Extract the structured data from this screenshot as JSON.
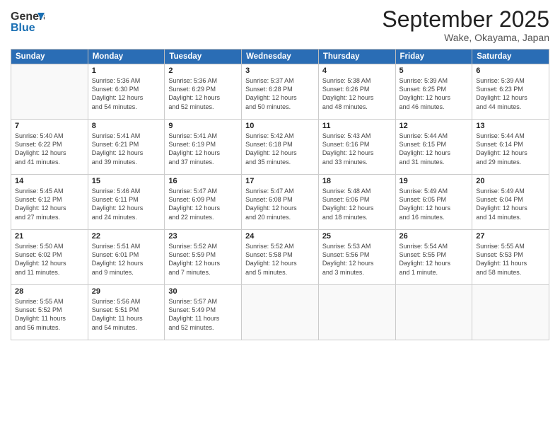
{
  "header": {
    "logo_general": "General",
    "logo_blue": "Blue",
    "title": "September 2025",
    "location": "Wake, Okayama, Japan"
  },
  "days_of_week": [
    "Sunday",
    "Monday",
    "Tuesday",
    "Wednesday",
    "Thursday",
    "Friday",
    "Saturday"
  ],
  "weeks": [
    [
      {
        "day": "",
        "info": ""
      },
      {
        "day": "1",
        "info": "Sunrise: 5:36 AM\nSunset: 6:30 PM\nDaylight: 12 hours\nand 54 minutes."
      },
      {
        "day": "2",
        "info": "Sunrise: 5:36 AM\nSunset: 6:29 PM\nDaylight: 12 hours\nand 52 minutes."
      },
      {
        "day": "3",
        "info": "Sunrise: 5:37 AM\nSunset: 6:28 PM\nDaylight: 12 hours\nand 50 minutes."
      },
      {
        "day": "4",
        "info": "Sunrise: 5:38 AM\nSunset: 6:26 PM\nDaylight: 12 hours\nand 48 minutes."
      },
      {
        "day": "5",
        "info": "Sunrise: 5:39 AM\nSunset: 6:25 PM\nDaylight: 12 hours\nand 46 minutes."
      },
      {
        "day": "6",
        "info": "Sunrise: 5:39 AM\nSunset: 6:23 PM\nDaylight: 12 hours\nand 44 minutes."
      }
    ],
    [
      {
        "day": "7",
        "info": "Sunrise: 5:40 AM\nSunset: 6:22 PM\nDaylight: 12 hours\nand 41 minutes."
      },
      {
        "day": "8",
        "info": "Sunrise: 5:41 AM\nSunset: 6:21 PM\nDaylight: 12 hours\nand 39 minutes."
      },
      {
        "day": "9",
        "info": "Sunrise: 5:41 AM\nSunset: 6:19 PM\nDaylight: 12 hours\nand 37 minutes."
      },
      {
        "day": "10",
        "info": "Sunrise: 5:42 AM\nSunset: 6:18 PM\nDaylight: 12 hours\nand 35 minutes."
      },
      {
        "day": "11",
        "info": "Sunrise: 5:43 AM\nSunset: 6:16 PM\nDaylight: 12 hours\nand 33 minutes."
      },
      {
        "day": "12",
        "info": "Sunrise: 5:44 AM\nSunset: 6:15 PM\nDaylight: 12 hours\nand 31 minutes."
      },
      {
        "day": "13",
        "info": "Sunrise: 5:44 AM\nSunset: 6:14 PM\nDaylight: 12 hours\nand 29 minutes."
      }
    ],
    [
      {
        "day": "14",
        "info": "Sunrise: 5:45 AM\nSunset: 6:12 PM\nDaylight: 12 hours\nand 27 minutes."
      },
      {
        "day": "15",
        "info": "Sunrise: 5:46 AM\nSunset: 6:11 PM\nDaylight: 12 hours\nand 24 minutes."
      },
      {
        "day": "16",
        "info": "Sunrise: 5:47 AM\nSunset: 6:09 PM\nDaylight: 12 hours\nand 22 minutes."
      },
      {
        "day": "17",
        "info": "Sunrise: 5:47 AM\nSunset: 6:08 PM\nDaylight: 12 hours\nand 20 minutes."
      },
      {
        "day": "18",
        "info": "Sunrise: 5:48 AM\nSunset: 6:06 PM\nDaylight: 12 hours\nand 18 minutes."
      },
      {
        "day": "19",
        "info": "Sunrise: 5:49 AM\nSunset: 6:05 PM\nDaylight: 12 hours\nand 16 minutes."
      },
      {
        "day": "20",
        "info": "Sunrise: 5:49 AM\nSunset: 6:04 PM\nDaylight: 12 hours\nand 14 minutes."
      }
    ],
    [
      {
        "day": "21",
        "info": "Sunrise: 5:50 AM\nSunset: 6:02 PM\nDaylight: 12 hours\nand 11 minutes."
      },
      {
        "day": "22",
        "info": "Sunrise: 5:51 AM\nSunset: 6:01 PM\nDaylight: 12 hours\nand 9 minutes."
      },
      {
        "day": "23",
        "info": "Sunrise: 5:52 AM\nSunset: 5:59 PM\nDaylight: 12 hours\nand 7 minutes."
      },
      {
        "day": "24",
        "info": "Sunrise: 5:52 AM\nSunset: 5:58 PM\nDaylight: 12 hours\nand 5 minutes."
      },
      {
        "day": "25",
        "info": "Sunrise: 5:53 AM\nSunset: 5:56 PM\nDaylight: 12 hours\nand 3 minutes."
      },
      {
        "day": "26",
        "info": "Sunrise: 5:54 AM\nSunset: 5:55 PM\nDaylight: 12 hours\nand 1 minute."
      },
      {
        "day": "27",
        "info": "Sunrise: 5:55 AM\nSunset: 5:53 PM\nDaylight: 11 hours\nand 58 minutes."
      }
    ],
    [
      {
        "day": "28",
        "info": "Sunrise: 5:55 AM\nSunset: 5:52 PM\nDaylight: 11 hours\nand 56 minutes."
      },
      {
        "day": "29",
        "info": "Sunrise: 5:56 AM\nSunset: 5:51 PM\nDaylight: 11 hours\nand 54 minutes."
      },
      {
        "day": "30",
        "info": "Sunrise: 5:57 AM\nSunset: 5:49 PM\nDaylight: 11 hours\nand 52 minutes."
      },
      {
        "day": "",
        "info": ""
      },
      {
        "day": "",
        "info": ""
      },
      {
        "day": "",
        "info": ""
      },
      {
        "day": "",
        "info": ""
      }
    ]
  ]
}
